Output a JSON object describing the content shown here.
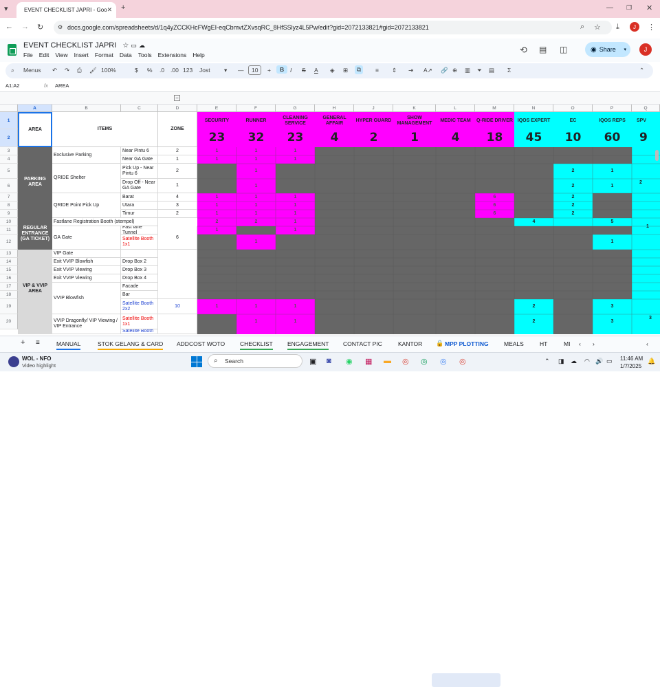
{
  "browser": {
    "tab_title": "EVENT CHECKLIST JAPRI - Goo",
    "url": "docs.google.com/spreadsheets/d/1q4yZCCKHcFWgEI-eqCbmvtZXvsqRC_8HfSSlyz4L5Pw/edit?gid=2072133821#gid=2072133821",
    "profile_initial": "J"
  },
  "sheets": {
    "title": "EVENT CHECKLIST JAPRI",
    "menus": [
      "File",
      "Edit",
      "View",
      "Insert",
      "Format",
      "Data",
      "Tools",
      "Extensions",
      "Help"
    ],
    "share_label": "Share",
    "toolbar": {
      "menus_label": "Menus",
      "zoom": "100%",
      "currency": "$",
      "percent": "%",
      "dec_dec": ".0",
      "dec_inc": ".00",
      "number_fmt": "123",
      "font": "Jost",
      "font_size": "10"
    },
    "name_box": "A1:A2",
    "formula": "AREA"
  },
  "columns": [
    "A",
    "B",
    "C",
    "D",
    "E",
    "F",
    "G",
    "H",
    "J",
    "K",
    "L",
    "M",
    "N",
    "O",
    "P",
    "Q"
  ],
  "rows": [
    "1",
    "2",
    "3",
    "4",
    "5",
    "6",
    "7",
    "8",
    "9",
    "10",
    "11",
    "12",
    "13",
    "14",
    "15",
    "16",
    "17",
    "18",
    "19",
    "20"
  ],
  "header": {
    "area": "AREA",
    "items": "ITEMS",
    "zone": "ZONE",
    "roles": [
      {
        "label": "SECURITY",
        "total": "23"
      },
      {
        "label": "RUNNER",
        "total": "32"
      },
      {
        "label": "CLEANING SERVICE",
        "total": "23"
      },
      {
        "label": "GENERAL AFFAIR",
        "total": "4"
      },
      {
        "label": "HYPER GUARD",
        "total": "2"
      },
      {
        "label": "SHOW MANAGEMENT",
        "total": "1"
      },
      {
        "label": "MEDIC TEAM",
        "total": "4"
      },
      {
        "label": "Q-RIDE DRIVER",
        "total": "18"
      },
      {
        "label": "IQOS EXPERT",
        "total": "45"
      },
      {
        "label": "EC",
        "total": "10"
      },
      {
        "label": "IQOS REPS",
        "total": "60"
      },
      {
        "label": "SPV",
        "total": "9"
      }
    ]
  },
  "areas": {
    "parking": "PARKING AREA",
    "regular": "REGULAR ENTRANCE (GA TICKET)",
    "vip": "VIP & VVIP AREA"
  },
  "items": {
    "r3": "Exclusive Parking",
    "r5": "QRIDE Shelter",
    "r7": "QRIDE Point Pick Up",
    "r10": "Fastlane Registration Booth (stempel)",
    "r11": "GA Gate",
    "r13": "VIP Gate",
    "r14": "Exit VVIP Blowfish",
    "r15": "Exit VVIP Viewing",
    "r16": "Exit VVIP Viewing",
    "r17": "VVIP Blowfish",
    "r20": "VVIP Dragonfly/ VIP Viewing / VIP Entrance"
  },
  "sub": {
    "r3": "Near Pintu 6",
    "r4": "Near GA Gate",
    "r5": "Pick Up - Near Pintu 6",
    "r6": "Drop Off - Near GA Gate",
    "r7": "Barat",
    "r8": "Utara",
    "r9": "Timur",
    "r11": "Fast lane Tunnel",
    "r12": "Satellite Booth 1x1",
    "r14": "Drop Box 2",
    "r15": "Drop Box 3",
    "r16": "Drop Box 4",
    "r17": "Facade",
    "r18": "Bar",
    "r19": "Satellite Booth 2x2",
    "r20": "Satellite Booth 1x1",
    "r21": "Satellite Booth"
  },
  "zones": {
    "r3": "2",
    "r4": "1",
    "r5": "2",
    "r6": "1",
    "r7": "4",
    "r8": "3",
    "r9": "2",
    "r11": "6",
    "r19": "10"
  },
  "vals": {
    "one": "1",
    "two": "2",
    "three": "3",
    "four": "4",
    "five": "5",
    "six": "6"
  },
  "sheet_tabs": [
    "MANUAL",
    "STOK GELANG & CARD",
    "ADDCOST WOTO",
    "CHECKLIST",
    "ENGAGEMENT",
    "CONTACT PIC",
    "KANTOR",
    "MPP PLOTTING",
    "MEALS",
    "HT",
    "MI"
  ],
  "active_sheet": "MPP PLOTTING",
  "taskbar": {
    "widget_title": "WOL - NFO",
    "widget_sub": "Video highlight",
    "search": "Search",
    "time": "11:46 AM",
    "date": "1/7/2025"
  },
  "colors": {
    "magenta": "#ff00ff",
    "cyan": "#00ffff",
    "dark_gray": "#666666",
    "light_gray": "#d9d9d9"
  }
}
